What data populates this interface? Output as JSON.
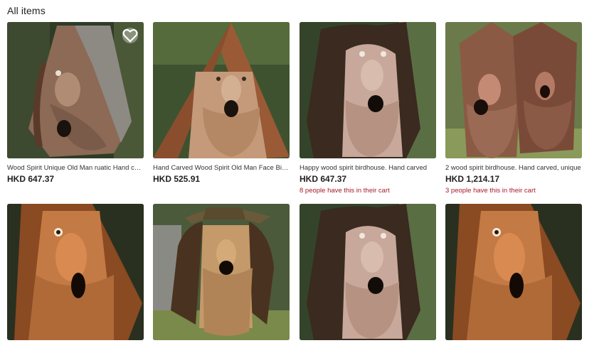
{
  "section": {
    "title": "All items"
  },
  "items": [
    {
      "title": "Wood Spirit Unique Old Man ruatic Hand carved Birdhouse",
      "price": "HKD 647.37",
      "cart_note": "",
      "scene": "longhair",
      "favorite_shown": true
    },
    {
      "title": "Hand Carved Wood Spirit Old Man Face Birdhouse",
      "price": "HKD 525.91",
      "cart_note": "",
      "scene": "roof",
      "favorite_shown": false
    },
    {
      "title": "Happy wood spirit birdhouse. Hand carved",
      "price": "HKD 647.37",
      "cart_note": "8 people have this in their cart",
      "scene": "darkhair",
      "favorite_shown": false
    },
    {
      "title": "2 wood spirit birdhouse. Hand carved, unique",
      "price": "HKD 1,214.17",
      "cart_note": "3 people have this in their cart",
      "scene": "pair",
      "favorite_shown": false
    },
    {
      "title": "",
      "price": "",
      "cart_note": "",
      "scene": "profile",
      "favorite_shown": false
    },
    {
      "title": "",
      "price": "",
      "cart_note": "",
      "scene": "hat",
      "favorite_shown": false
    },
    {
      "title": "",
      "price": "",
      "cart_note": "",
      "scene": "darkhair",
      "favorite_shown": false
    },
    {
      "title": "",
      "price": "",
      "cart_note": "",
      "scene": "profile",
      "favorite_shown": false
    }
  ]
}
